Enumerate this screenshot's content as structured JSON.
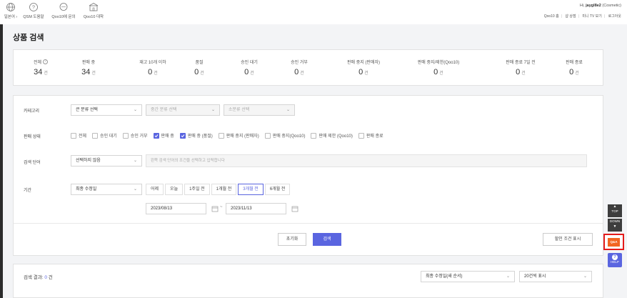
{
  "topnav": [
    {
      "icon": "globe-icon",
      "label": "일본어 ›"
    },
    {
      "icon": "question-icon",
      "label": "QSM 도움말"
    },
    {
      "icon": "chat-icon",
      "label": "Qoo10에 문의"
    },
    {
      "icon": "school-icon",
      "label": "Qoo10 대학"
    }
  ],
  "greeting": {
    "prefix": "Hi, ",
    "user": "jaygl8e2",
    "suffix": " (Cosmetic)"
  },
  "toplinks": [
    "Qoo10 홈",
    "샵 상점",
    "미니 TV 보기",
    "로그아웃"
  ],
  "page_title": "상품 검색",
  "stats": [
    {
      "label": "전체",
      "value": "34",
      "unit": "건",
      "help": true
    },
    {
      "label": "판매 중",
      "value": "34",
      "unit": "건"
    },
    {
      "label": "재고 10개 이하",
      "value": "0",
      "unit": "건"
    },
    {
      "label": "품절",
      "value": "0",
      "unit": "건"
    },
    {
      "label": "승인 대기",
      "value": "0",
      "unit": "건"
    },
    {
      "label": "승인 거부",
      "value": "0",
      "unit": "건"
    },
    {
      "label": "판매 중지 (판매자)",
      "value": "0",
      "unit": "건"
    },
    {
      "label": "판매 중지/제한(Qoo10)",
      "value": "0",
      "unit": "건"
    },
    {
      "label": "판매 종료 7일 전",
      "value": "0",
      "unit": "건"
    },
    {
      "label": "판매 종료",
      "value": "0",
      "unit": "건"
    }
  ],
  "filter": {
    "category_label": "카테고리",
    "category_large": "큰 분류 선택",
    "category_medium": "중간 분류 선택",
    "category_small": "소분류 선택",
    "status_label": "판매 상태",
    "status_options": [
      {
        "label": "전체",
        "checked": false
      },
      {
        "label": "승인 대기",
        "checked": false
      },
      {
        "label": "승인 거부",
        "checked": false
      },
      {
        "label": "판매 중",
        "checked": true
      },
      {
        "label": "판매 중 (품절)",
        "checked": true
      },
      {
        "label": "판매 중지 (판매자)",
        "checked": false
      },
      {
        "label": "판매 중지(Qoo10)",
        "checked": false
      },
      {
        "label": "판매 제한 (Qoo10)",
        "checked": false
      },
      {
        "label": "판매 종료",
        "checked": false
      }
    ],
    "keyword_label": "검색 단어",
    "keyword_select": "선택하지 않음",
    "keyword_placeholder": "왼쪽 검색 단어의 조건을 선택하고 입력합니다",
    "period_label": "기간",
    "period_select": "최종 수정일",
    "period_buttons": [
      {
        "label": "어제",
        "active": false
      },
      {
        "label": "오늘",
        "active": false
      },
      {
        "label": "1주일 전",
        "active": false
      },
      {
        "label": "1개월 전",
        "active": false
      },
      {
        "label": "3개월 전",
        "active": true
      },
      {
        "label": "6개월 전",
        "active": false
      }
    ],
    "date_from": "2023/08/13",
    "date_to": "2023/11/13",
    "tilde": "~",
    "reset_label": "초기화",
    "search_label": "검색",
    "discount_label": "할인 조건 표시"
  },
  "result": {
    "title": "검색 결과: ",
    "count": "0",
    "unit": " 건",
    "sort": "최종 수정일(새 순서)",
    "per_page": "20건씩 표시"
  },
  "float": {
    "top": "TOP",
    "down": "DOWN",
    "qa": "Q&A",
    "help": "HELP"
  },
  "colors": {
    "accent": "#5a65e0",
    "qa": "#f26522",
    "highlight": "#e41b1b"
  }
}
